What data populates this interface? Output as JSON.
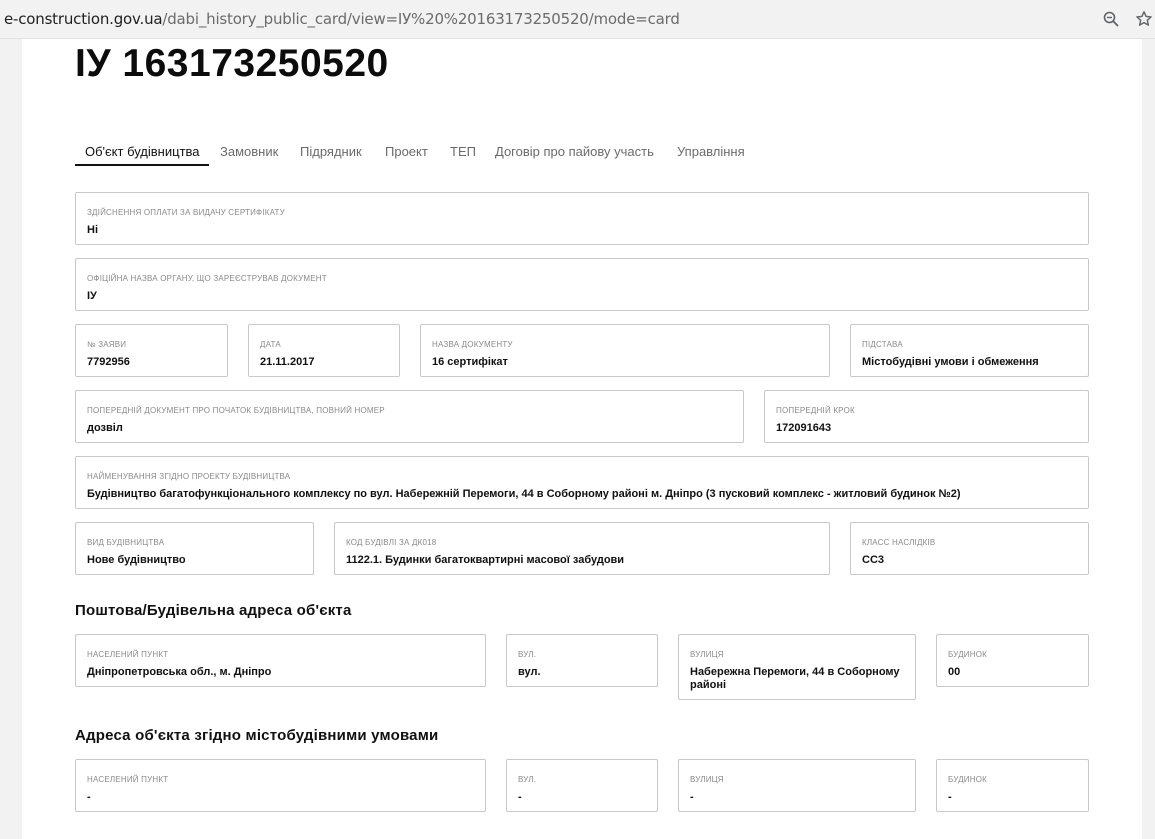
{
  "browser": {
    "url_host": "e-construction.gov.ua",
    "url_path": "/dabi_history_public_card/view=ІУ%20%20163173250520/mode=card"
  },
  "page": {
    "title": "ІУ 163173250520"
  },
  "tabs": [
    {
      "label": "Об'єкт будівництва",
      "active": true
    },
    {
      "label": "Замовник"
    },
    {
      "label": "Підрядник"
    },
    {
      "label": "Проект"
    },
    {
      "label": "ТЕП"
    },
    {
      "label": "Договір про пайову участь"
    },
    {
      "label": "Управління"
    }
  ],
  "fields": {
    "payment": {
      "label": "Здійснення оплати за видачу сертифікату",
      "value": "Ні"
    },
    "authority": {
      "label": "Офіційна назва органу, що зареєстрував документ",
      "value": "ІУ"
    },
    "application_no": {
      "label": "№ заяви",
      "value": "7792956"
    },
    "date": {
      "label": "Дата",
      "value": "21.11.2017"
    },
    "doc_name": {
      "label": "Назва документу",
      "value": "16 сертифікат"
    },
    "basis": {
      "label": "Підстава",
      "value": "Містобудівні умови і обмеження"
    },
    "prev_doc": {
      "label": "Попередній документ про початок будівництва, повний номер",
      "value": "дозвіл"
    },
    "prev_step": {
      "label": "Попередній крок",
      "value": "172091643"
    },
    "project_name": {
      "label": "Найменування згідно проекту будівництва",
      "value": "Будівництво багатофункціонального комплексу по вул. Набережній Перемоги, 44 в Соборному районі м. Дніпро (3 пусковий комплекс - житловий будинок №2)"
    },
    "construction_type": {
      "label": "Вид будівництва",
      "value": "Нове будівництво"
    },
    "building_code": {
      "label": "Код будівлі за ДК018",
      "value": "1122.1. Будинки багатоквартирні масової забудови"
    },
    "consequence_class": {
      "label": "Класс наслідків",
      "value": "СС3"
    }
  },
  "postal_address": {
    "title": "Поштова/Будівельна адреса об'єкта",
    "locality": {
      "label": "Населений пункт",
      "value": "Дніпропетровська обл., м. Дніпро"
    },
    "street_type": {
      "label": "Вул.",
      "value": "вул."
    },
    "street": {
      "label": "Вулиця",
      "value": "Набережна Перемоги, 44 в Соборному районі"
    },
    "building": {
      "label": "Будинок",
      "value": "00"
    }
  },
  "planning_address": {
    "title": "Адреса об'єкта згідно містобудівними умовами",
    "locality": {
      "label": "Населений пункт",
      "value": "-"
    },
    "street_type": {
      "label": "Вул.",
      "value": "-"
    },
    "street": {
      "label": "Вулиця",
      "value": "-"
    },
    "building": {
      "label": "Будинок",
      "value": "-"
    }
  }
}
